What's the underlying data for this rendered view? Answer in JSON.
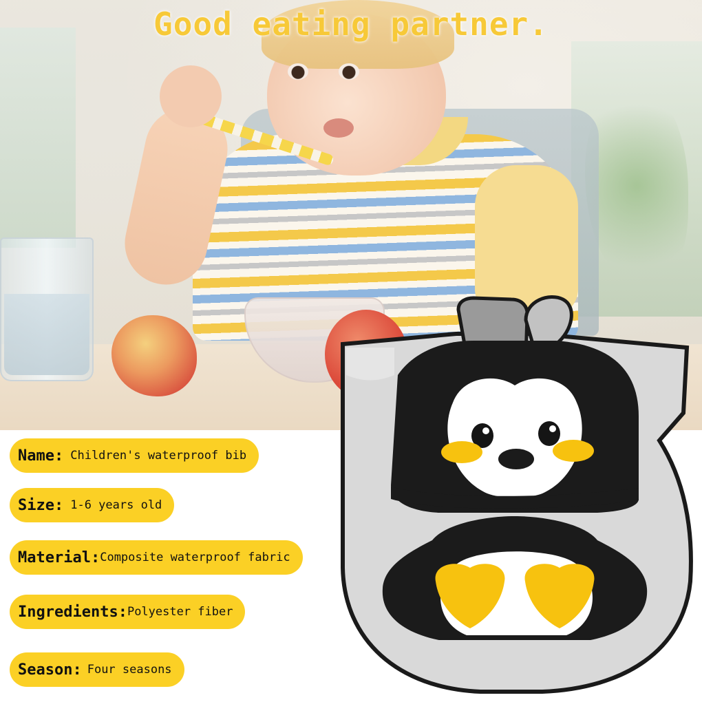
{
  "headline": "Good eating partner.",
  "specs": [
    {
      "key": "Name:",
      "value": "Children's waterproof bib"
    },
    {
      "key": "Size:",
      "value": "1-6 years old"
    },
    {
      "key": "Material:",
      "value": "Composite waterproof fabric"
    },
    {
      "key": "Ingredients:",
      "value": "Polyester fiber"
    },
    {
      "key": "Season:",
      "value": "Four seasons"
    }
  ],
  "colors": {
    "accent_yellow": "#fbd025",
    "headline_yellow": "#f7c938",
    "bib_gray": "#d9d9d9",
    "bib_black": "#1a1a1a",
    "penguin_yellow": "#f7c20f"
  }
}
